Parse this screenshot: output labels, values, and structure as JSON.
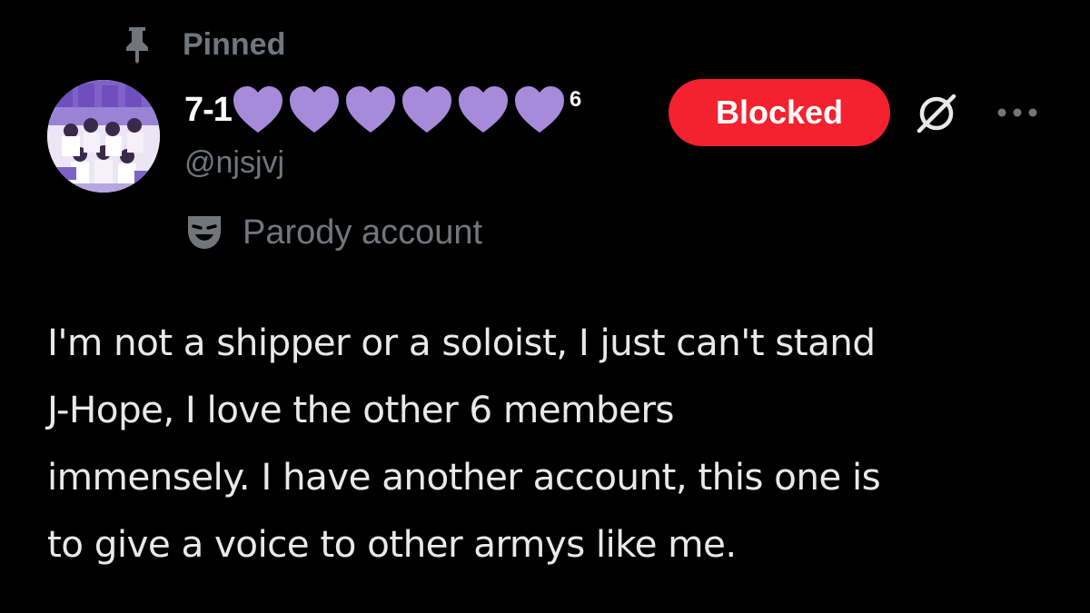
{
  "pinned": {
    "label": "Pinned",
    "icon": "pin-icon"
  },
  "user": {
    "display_name_prefix": "7-1",
    "hearts_count": 6,
    "heart_color": "#a78bdb",
    "display_name_suffix": "6",
    "handle": "@njsjvj",
    "avatar_icon": "avatar"
  },
  "actions": {
    "blocked_label": "Blocked",
    "blocked_color": "#f4212e",
    "grok_icon": "grok-icon",
    "more_icon": "more-icon"
  },
  "label": {
    "parody_text": "Parody account",
    "icon": "mask-icon"
  },
  "post": {
    "text": "I'm not a shipper or a soloist, I just can't stand\nJ-Hope, I love the other 6 members\nimmensely. I have another account, this one is\nto give a voice to other armys like me."
  },
  "colors": {
    "background": "#000000",
    "primary_text": "#e7e9ea",
    "secondary_text": "#71767b"
  }
}
